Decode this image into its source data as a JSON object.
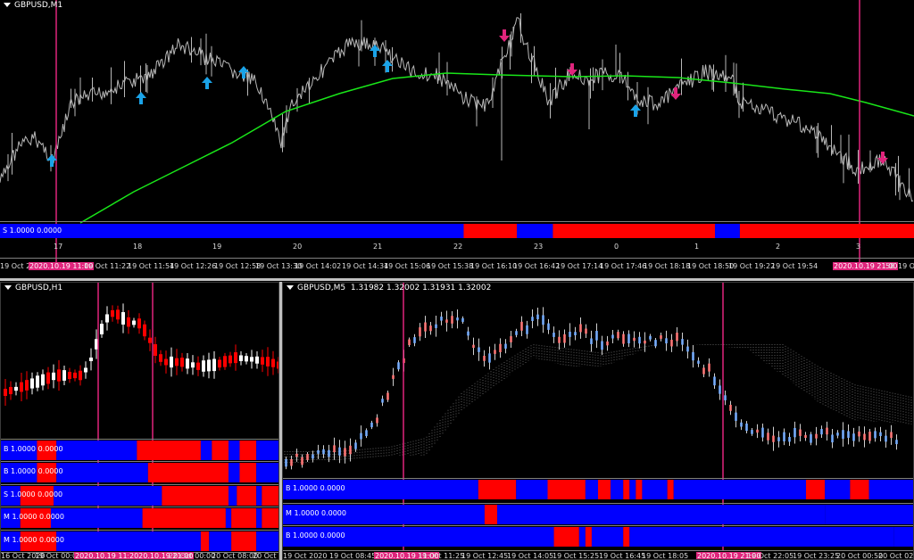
{
  "colors": {
    "bear": "#ff0000",
    "bull": "#0000ff",
    "marker": "#e0247c",
    "ma": "#19e619",
    "up_arrow": "#1aa3e8",
    "down_arrow": "#e0247c"
  },
  "top_chart": {
    "title": "GBPUSD,M1",
    "indicator_label": "S 1.0000 0.0000",
    "hour_labels": [
      "17",
      "18",
      "19",
      "20",
      "21",
      "22",
      "23",
      "0",
      "1",
      "2",
      "3"
    ],
    "time_labels": [
      "19 Oct 202",
      "2020.10.19 11:00",
      "19 Oct 11:22",
      "19 Oct 11:54",
      "19 Oct 12:26",
      "19 Oct 12:58",
      "19 Oct 13:30",
      "19 Oct 14:02",
      "19 Oct 14:34",
      "19 Oct 15:06",
      "19 Oct 15:38",
      "19 Oct 16:10",
      "19 Oct 16:42",
      "19 Oct 17:14",
      "19 Oct 17:46",
      "19 Oct 18:18",
      "19 Oct 18:50",
      "19 Oct 19:22",
      "19 Oct 19:54",
      "2020.10.19 21:00",
      "58",
      "19 Oct"
    ]
  },
  "left_chart": {
    "title": "GBPUSD,H1",
    "indicator_labels": [
      "B 1.0000 0.0000",
      "B 1.0000 0.0000",
      "S 1.0000 0.0000",
      "M 1.0000 0.0000",
      "M 1.0000 0.0000"
    ],
    "time_labels": [
      "16 Oct 2020",
      "19 Oct 00:0",
      "2020.10.19 11:00",
      "2020.10.19 21:00",
      "20 Oct 00:00",
      "20 Oct 08:00",
      "20 Oct 16:00"
    ]
  },
  "right_chart": {
    "title": "GBPUSD,M5",
    "ohlc": "1.31982 1.32002 1.31931 1.32002",
    "indicator_labels": [
      "B 1.0000 0.0000",
      "M 1.0000 0.0000",
      "B 1.0000 0.0000"
    ],
    "time_labels": [
      "19 Oct 2020",
      "19 Oct 08:45",
      "2020.10.19 11:00",
      "19 Oct 11:25",
      "19 Oct 12:45",
      "19 Oct 14:05",
      "19 Oct 15:25",
      "19 Oct 16:45",
      "19 Oct 18:05",
      "2020.10.19 21:00",
      "19 Oct 22:05",
      "19 Oct 23:25",
      "20 Oct 00:50",
      "20 Oct 02:1"
    ]
  }
}
